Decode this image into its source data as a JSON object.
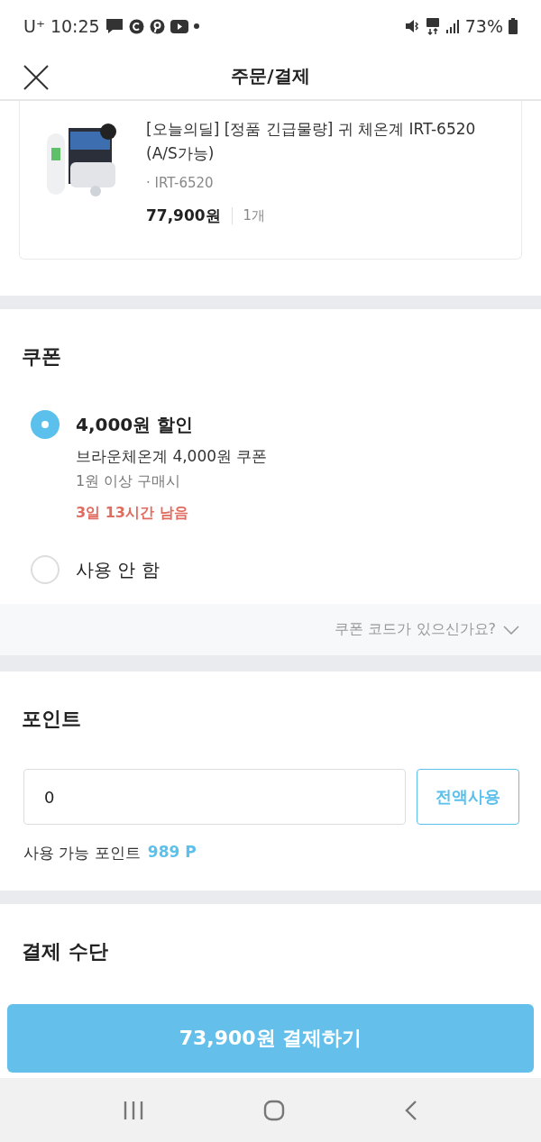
{
  "status_bar": {
    "carrier": "U⁺",
    "time": "10:25",
    "battery": "73%"
  },
  "header": {
    "title": "주문/결제"
  },
  "product": {
    "name": "[오늘의딜] [정품 긴급물량] 귀 체온계 IRT-6520 (A/S가능)",
    "option": "· IRT-6520",
    "price": "77,900원",
    "quantity": "1개"
  },
  "coupon": {
    "title": "쿠폰",
    "options": [
      {
        "kind": "coupon",
        "selected": true,
        "title": "4,000원 할인",
        "description": "브라운체온계 4,000원 쿠폰",
        "condition": "1원 이상 구매시",
        "remaining": "3일 13시간 남음"
      },
      {
        "kind": "none",
        "selected": false,
        "title": "사용 안 함"
      }
    ],
    "code_link": "쿠폰 코드가 있으신가요?"
  },
  "points": {
    "title": "포인트",
    "value": "0",
    "use_all": "전액사용",
    "available_label": "사용 가능 포인트",
    "available": "989 P"
  },
  "payment": {
    "title": "결제 수단"
  },
  "pay_button": "73,900원 결제하기"
}
